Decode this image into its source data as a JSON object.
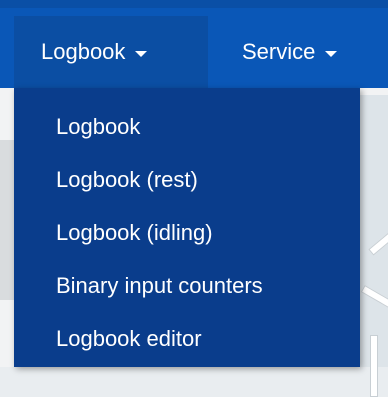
{
  "nav": {
    "logbook_label": "Logbook",
    "service_label": "Service"
  },
  "dropdown": {
    "items": [
      {
        "label": "Logbook"
      },
      {
        "label": "Logbook (rest)"
      },
      {
        "label": "Logbook (idling)"
      },
      {
        "label": "Binary input counters"
      },
      {
        "label": "Logbook editor"
      }
    ]
  },
  "colors": {
    "navbar": "#0a57b7",
    "active_nav": "#0b4ea3",
    "dropdown_bg": "#0a3d8c",
    "text": "#ffffff"
  },
  "icons": {
    "dropdown_caret": "caret-down-icon"
  }
}
